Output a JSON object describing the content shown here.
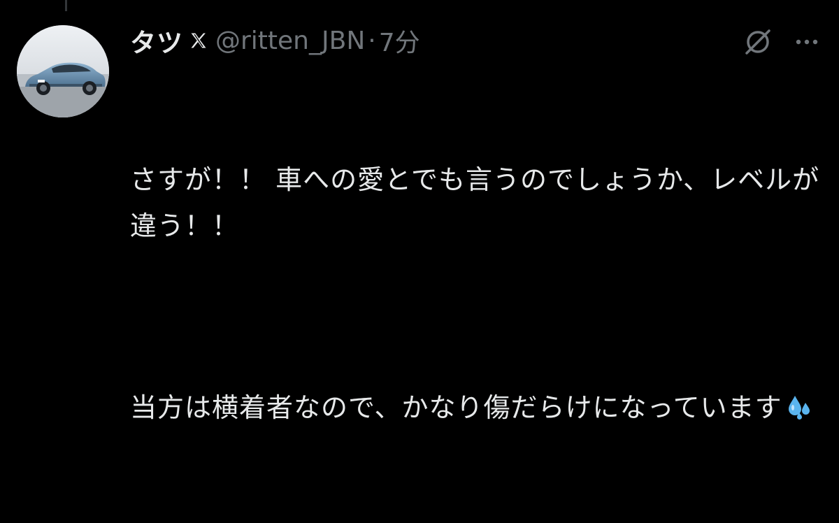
{
  "tweet": {
    "author": {
      "display_name": "タツ",
      "badge_icon": "x-logo-icon",
      "handle": "@ritten_JBN",
      "avatar_icon": "car-avatar-photo"
    },
    "separator": "·",
    "time": "7分",
    "actions": {
      "grok_icon": "grok-icon",
      "more_icon": "more-options-icon"
    },
    "text": {
      "paragraph_1": "さすが！！ 車への愛とでも言うのでしょうか、レベルが違う！！",
      "paragraph_2": "当方は横着者なので、かなり傷だらけになっています",
      "emoji_icon": "sweat-droplets-emoji"
    }
  },
  "colors": {
    "background": "#000000",
    "primary_text": "#e7e9ea",
    "secondary_text": "#71767b",
    "thread_line": "#333639"
  }
}
